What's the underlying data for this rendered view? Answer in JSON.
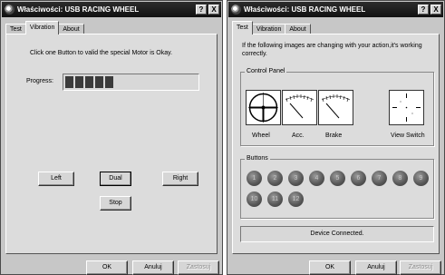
{
  "left_window": {
    "title": "Właściwości: USB RACING WHEEL",
    "help_button": "?",
    "close_button": "X",
    "tabs": [
      "Test",
      "Vibration",
      "About"
    ],
    "active_tab": "Vibration",
    "instruction": "Click one Button to valid the special Motor is Okay.",
    "progress_label": "Progress:",
    "progress_value": 0.29,
    "buttons": {
      "left": "Left",
      "dual": "Dual",
      "right": "Right",
      "stop": "Stop"
    },
    "footer": {
      "ok": "OK",
      "cancel": "Anuluj",
      "apply": "Zastosuj"
    }
  },
  "right_window": {
    "title": "Właściwości: USB RACING WHEEL",
    "help_button": "?",
    "close_button": "X",
    "tabs": [
      "Test",
      "Vibration",
      "About"
    ],
    "active_tab": "Test",
    "instruction": "If the following images are changing with your action,it's working correctly.",
    "control_panel": {
      "label": "Control Panel",
      "wheel": "Wheel",
      "acc": "Acc.",
      "brake": "Brake",
      "view_switch": "View Switch"
    },
    "buttons_group": {
      "label": "Buttons",
      "items": [
        "1",
        "2",
        "3",
        "4",
        "5",
        "6",
        "7",
        "8",
        "9",
        "10",
        "11",
        "12"
      ]
    },
    "status": "Device Connected.",
    "footer": {
      "ok": "OK",
      "cancel": "Anuluj",
      "apply": "Zastosuj"
    }
  }
}
